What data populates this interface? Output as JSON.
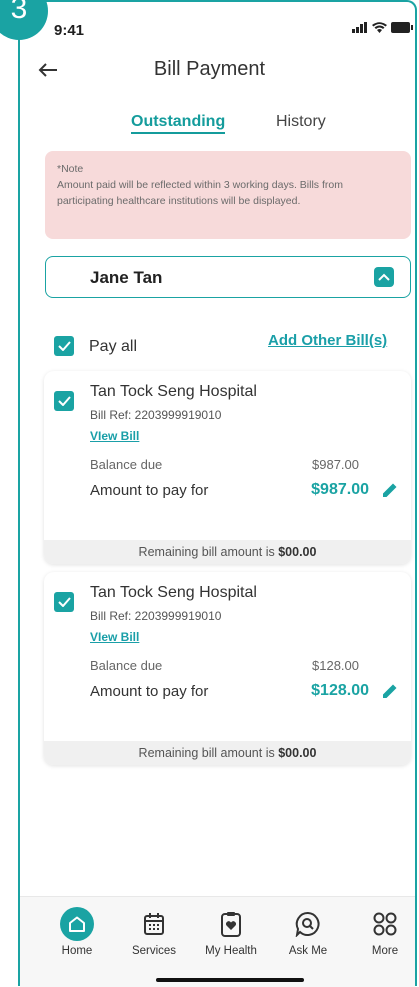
{
  "step": "3",
  "status": {
    "time": "9:41"
  },
  "header": {
    "title": "Bill Payment"
  },
  "tabs": [
    {
      "label": "Outstanding",
      "active": true
    },
    {
      "label": "History",
      "active": false
    }
  ],
  "note": {
    "title": "*Note",
    "body": "Amount paid will be reflected within 3 working days. Bills from participating healthcare institutions will be displayed."
  },
  "patient": {
    "name": "Jane Tan"
  },
  "pay_all": {
    "label": "Pay all",
    "checked": true
  },
  "add_bill": {
    "label": "Add Other Bill(s)"
  },
  "bills": [
    {
      "hospital": "Tan Tock Seng Hospital",
      "ref": "Bill Ref: 2203999919010",
      "view_label": "VIew Bill",
      "balance_label": "Balance due",
      "balance_value": "$987.00",
      "amount_label": "Amount to pay for",
      "amount_value": "$987.00",
      "remaining_text": "Remaining bill amount is",
      "remaining_value": "$00.00"
    },
    {
      "hospital": "Tan Tock Seng Hospital",
      "ref": "Bill Ref: 2203999919010",
      "view_label": "VIew Bill",
      "balance_label": "Balance due",
      "balance_value": "$128.00",
      "amount_label": "Amount to pay for",
      "amount_value": "$128.00",
      "remaining_text": "Remaining bill amount is",
      "remaining_value": "$00.00"
    }
  ],
  "nav": [
    {
      "label": "Home",
      "icon": "home-icon"
    },
    {
      "label": "Services",
      "icon": "calendar-icon"
    },
    {
      "label": "My Health",
      "icon": "clipboard-heart-icon"
    },
    {
      "label": "Ask Me",
      "icon": "chat-search-icon"
    },
    {
      "label": "More",
      "icon": "grid-icon"
    }
  ],
  "colors": {
    "accent": "#1aa3a3",
    "note_bg": "#f7dada"
  }
}
